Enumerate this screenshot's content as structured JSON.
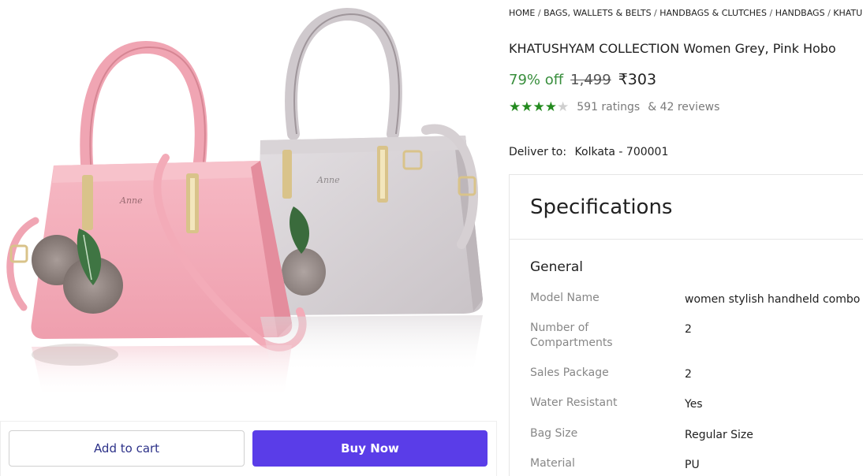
{
  "buttons": {
    "add_to_cart": "Add to cart",
    "buy_now": "Buy Now"
  },
  "breadcrumb": [
    "HOME",
    "BAGS, WALLETS & BELTS",
    "HANDBAGS & CLUTCHES",
    "HANDBAGS",
    "KHATUSHYAM COLLECTION HANDBAGS"
  ],
  "product": {
    "title": "KHATUSHYAM COLLECTION Women Grey, Pink Hobo",
    "discount": "79% off",
    "mrp": "1,499",
    "price": "₹303",
    "rating_stars": 4,
    "rating_max": 5,
    "ratings_count": "591 ratings",
    "reviews_count": "& 42 reviews",
    "bag_logo_text": "Anne"
  },
  "delivery": {
    "label": "Deliver to:",
    "location": "Kolkata - 700001"
  },
  "specs": {
    "title": "Specifications",
    "group": "General",
    "rows": [
      {
        "key": "Model Name",
        "value": "women stylish handheld combo MS"
      },
      {
        "key": "Number of Compartments",
        "value": "2"
      },
      {
        "key": "Sales Package",
        "value": "2"
      },
      {
        "key": "Water Resistant",
        "value": "Yes"
      },
      {
        "key": "Bag Size",
        "value": "Regular Size"
      },
      {
        "key": "Material",
        "value": "PU"
      }
    ]
  },
  "colors": {
    "accent_green": "#388e3c",
    "buy_button": "#5a3de8",
    "cart_text": "#2d3289",
    "bag_pink": "#f2a9b6",
    "bag_grey": "#d8d3d6"
  }
}
